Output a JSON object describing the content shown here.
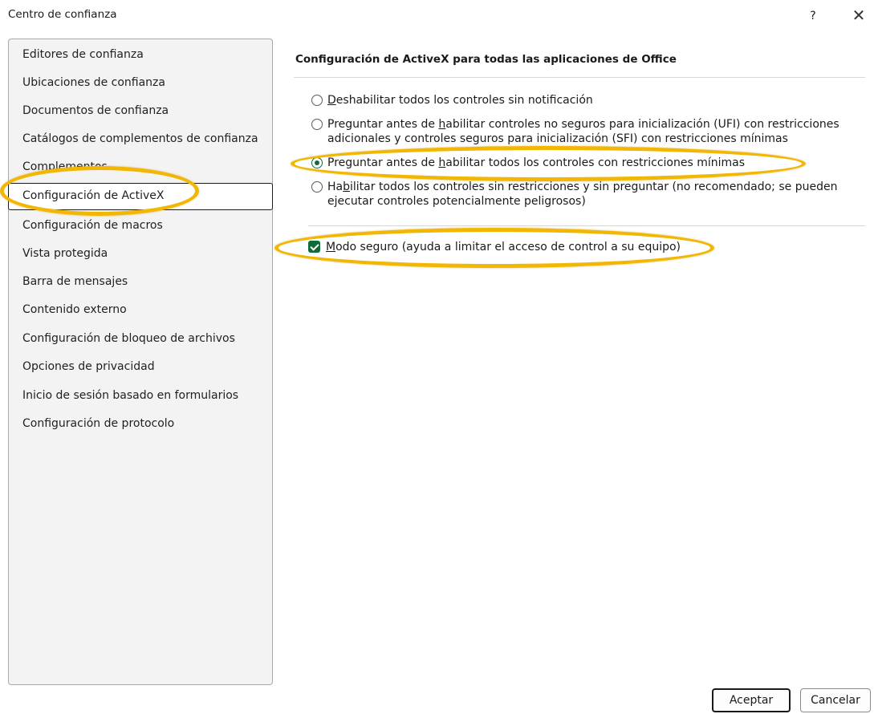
{
  "dialog": {
    "title": "Centro de confianza",
    "help_label": "?",
    "close_label": "✕"
  },
  "sidebar": {
    "items": [
      {
        "label": "Editores de confianza"
      },
      {
        "label": "Ubicaciones de confianza"
      },
      {
        "label": "Documentos de confianza"
      },
      {
        "label": "Catálogos de complementos de confianza"
      },
      {
        "label": "Complementos"
      },
      {
        "label": "Configuración de ActiveX",
        "selected": true
      },
      {
        "label": "Configuración de macros"
      },
      {
        "label": "Vista protegida"
      },
      {
        "label": "Barra de mensajes"
      },
      {
        "label": "Contenido externo"
      },
      {
        "label": "Configuración de bloqueo de archivos"
      },
      {
        "label": "Opciones de privacidad"
      },
      {
        "label": "Inicio de sesión basado en formularios"
      },
      {
        "label": "Configuración de protocolo"
      }
    ]
  },
  "main": {
    "section_title": "Configuración de ActiveX para todas las aplicaciones de Office",
    "options": [
      {
        "pre": "",
        "underlined": "D",
        "post": "eshabilitar todos los controles sin notificación",
        "checked": false
      },
      {
        "pre": "Preguntar antes de ",
        "underlined": "h",
        "post": "abilitar controles no seguros para inicialización (UFI) con restricciones adicionales y controles seguros para inicialización (SFI) con restricciones mínimas",
        "checked": false
      },
      {
        "pre": "Preguntar antes de ",
        "underlined": "h",
        "post": "abilitar todos los controles con restricciones mínimas",
        "checked": true
      },
      {
        "pre": "Ha",
        "underlined": "b",
        "post": "ilitar todos los controles sin restricciones y sin preguntar (no recomendado; se pueden ejecutar controles potencialmente peligrosos)",
        "checked": false
      }
    ],
    "safe_mode": {
      "underlined": "M",
      "rest": "odo seguro (ayuda a limitar el acceso de control a su equipo)",
      "checked": true
    }
  },
  "footer": {
    "ok_label": "Aceptar",
    "cancel_label": "Cancelar"
  },
  "colors": {
    "accent_green": "#0f6b3a",
    "highlight": "#f2b705"
  }
}
